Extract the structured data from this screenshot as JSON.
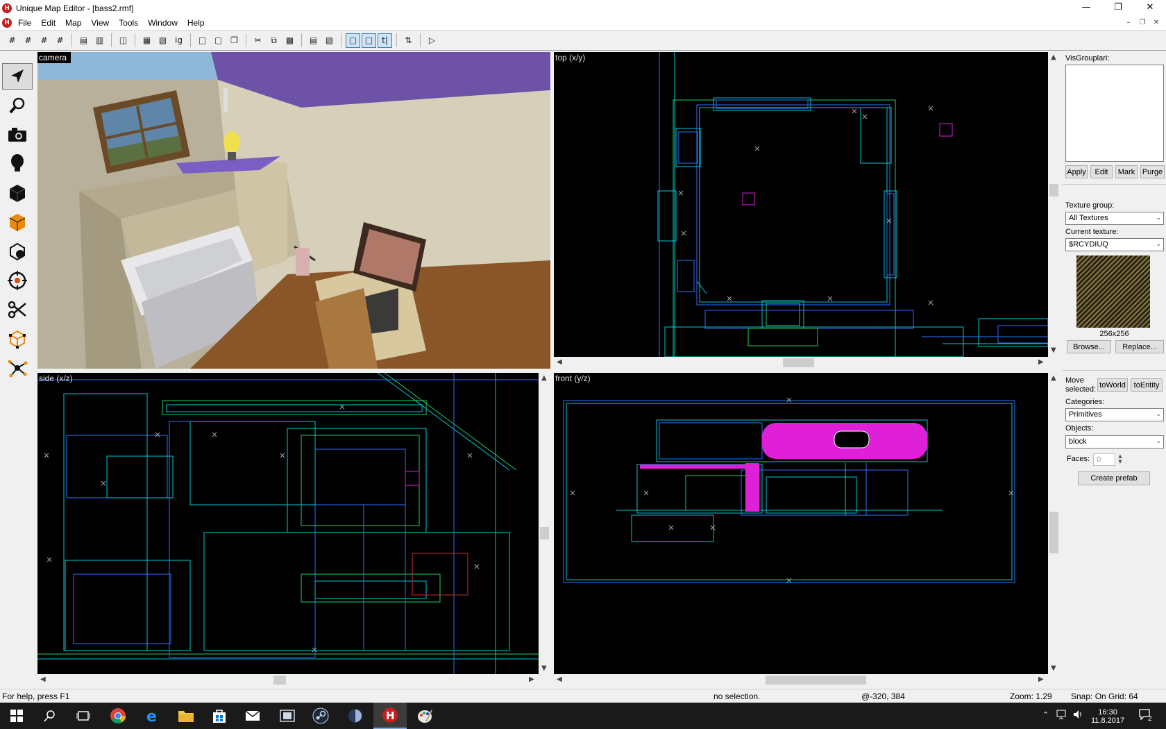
{
  "window": {
    "title": "Unique Map Editor - [bass2.rmf]",
    "app_icon_letter": "H",
    "controls": [
      "—",
      "❐",
      "✕"
    ],
    "mdi_controls": [
      "–",
      "❐",
      "✕"
    ]
  },
  "menu": [
    "File",
    "Edit",
    "Map",
    "View",
    "Tools",
    "Window",
    "Help"
  ],
  "toolbar": {
    "icons": [
      "grid-icon",
      "grid-smaller-icon",
      "grid-larger-icon",
      "grid-toggle-icon",
      "copy-icon",
      "paste-icon",
      "undo-icon",
      "group-icon",
      "ungroup-icon",
      "ignore-group-icon",
      "hide-icon",
      "show-icon",
      "hide-others-icon",
      "cut-icon",
      "copy2-icon",
      "paste2-icon",
      "texture-lock-icon",
      "texture-scale-lock-icon",
      "tie-to-world-icon",
      "selection-icon",
      "texture-app-icon",
      "flip-icon",
      "run-icon"
    ]
  },
  "palette": {
    "tools": [
      "selection-tool-icon",
      "magnify-tool-icon",
      "camera-tool-icon",
      "entity-tool-icon",
      "block-tool-icon",
      "texture-tool-icon",
      "apply-decal-tool-icon",
      "cordon-tool-icon",
      "clip-tool-icon",
      "vertex-tool-icon",
      "path-tool-icon"
    ]
  },
  "viewports": {
    "camera": {
      "label": "camera"
    },
    "top": {
      "label": "top (x/y)"
    },
    "side": {
      "label": "side (x/z)"
    },
    "front": {
      "label": "front (y/z)"
    }
  },
  "panel": {
    "visgroups_label": "VisGrouplari:",
    "vis_buttons": [
      "Apply",
      "Edit",
      "Mark",
      "Purge"
    ],
    "texture_group_label": "Texture group:",
    "texture_group_value": "All Textures",
    "current_texture_label": "Current texture:",
    "current_texture_value": "$RCYDIUQ",
    "texture_size": "256x256",
    "browse_label": "Browse...",
    "replace_label": "Replace...",
    "move_selected_label_1": "Move",
    "move_selected_label_2": "selected:",
    "to_world_label": "toWorld",
    "to_entity_label": "toEntity",
    "categories_label": "Categories:",
    "categories_value": "Primitives",
    "objects_label": "Objects:",
    "objects_value": "block",
    "faces_label": "Faces:",
    "faces_value": "0",
    "create_prefab_label": "Create prefab"
  },
  "status": {
    "help": "For help, press F1",
    "selection": "no selection.",
    "coords": "@-320, 384",
    "zoom": "Zoom: 1.29",
    "snap": "Snap: On Grid: 64"
  },
  "taskbar": {
    "apps": [
      "start-icon",
      "search-icon",
      "task-view-icon",
      "chrome-icon",
      "edge-icon",
      "file-explorer-icon",
      "store-icon",
      "mail-icon",
      "media-icon",
      "steam-icon",
      "app-icon",
      "hammer-icon",
      "paint-icon"
    ],
    "time": "16:30",
    "date": "11.8.2017",
    "notification_count": "2"
  },
  "colors": {
    "wire_cyan": "#00c8d8",
    "wire_blue": "#2f6fff",
    "wire_green": "#20d060",
    "magenta": "#e020d8",
    "accent": "#0078d7"
  }
}
